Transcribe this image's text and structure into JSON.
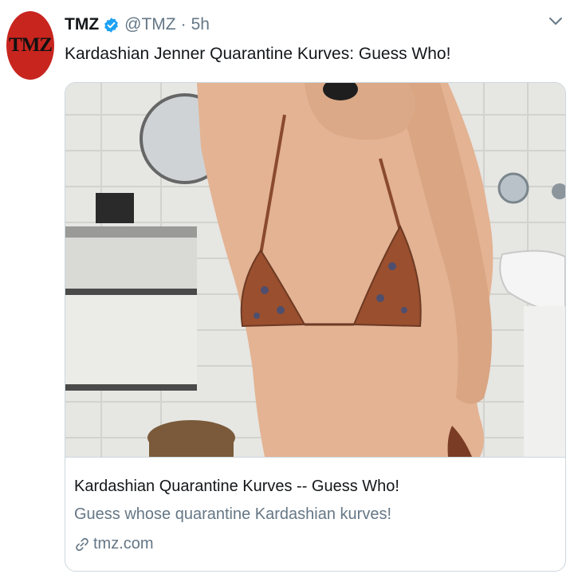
{
  "tweet": {
    "author_name": "TMZ",
    "handle": "@TMZ",
    "separator": "·",
    "time": "5h",
    "avatar_text": "TMZ",
    "text": "Kardashian Jenner Quarantine Kurves: Guess Who!"
  },
  "card": {
    "title": "Kardashian Quarantine Kurves -- Guess Who!",
    "description": "Guess whose quarantine Kardashian kurves!",
    "domain": "tmz.com"
  },
  "icons": {
    "verified": "verified-badge-icon",
    "menu": "chevron-down-icon",
    "link": "link-icon"
  },
  "colors": {
    "verified_blue": "#1da1f2",
    "avatar_red": "#c8251f",
    "secondary_text": "#657786",
    "border": "#ccd6dd"
  }
}
